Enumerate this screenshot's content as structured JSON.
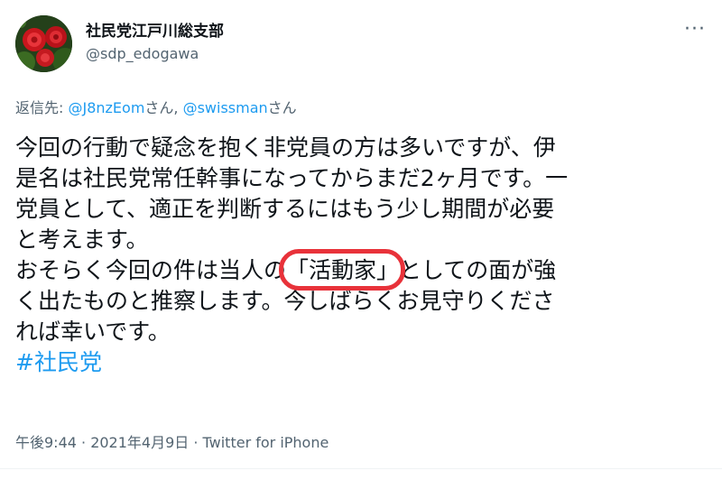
{
  "author": {
    "display_name": "社民党江戸川総支部",
    "handle": "@sdp_edogawa",
    "avatar_icon": "rose-flowers-avatar"
  },
  "more_icon": "more-dots-icon",
  "reply": {
    "label": "返信先: ",
    "mention_1": "@J8nzEom",
    "suffix_1": "さん, ",
    "mention_2": "@swissman",
    "suffix_2": "さん"
  },
  "body": {
    "line1": "今回の行動で疑念を抱く非党員の方は多いですが、伊",
    "line2": "是名は社民党常任幹事になってからまだ2ヶ月です。一",
    "line3": "党員として、適正を判断するにはもう少し期間が必要",
    "line4": "と考えます。",
    "line5_before": "おそらく今回の件は当人の",
    "line5_highlight": "「活動家」",
    "line5_after": "としての面が強",
    "line6": "く出たものと推察します。今しばらくお見守りくださ",
    "line7": "れば幸いです。",
    "hashtag": "#社民党"
  },
  "meta": "午後9:44 · 2021年4月9日 · Twitter for iPhone",
  "colors": {
    "link": "#1d9bf0",
    "text": "#0f1419",
    "secondary": "#536471",
    "annotation_circle": "#e8323a"
  }
}
